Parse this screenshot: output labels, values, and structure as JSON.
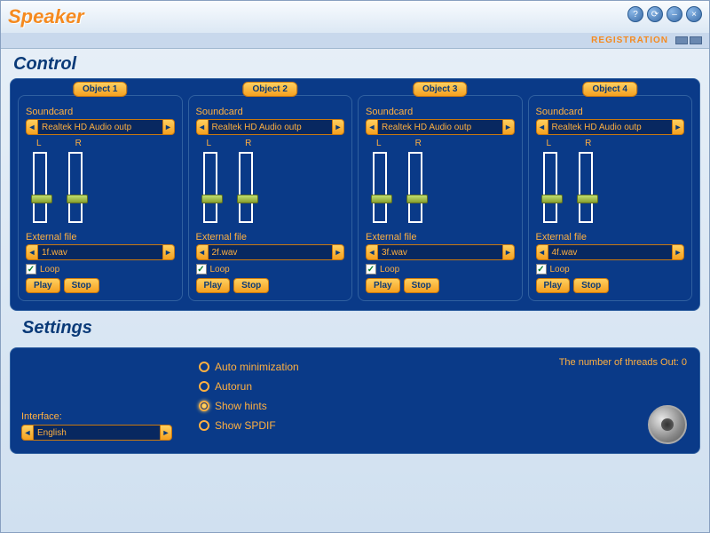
{
  "app": {
    "title": "Speaker",
    "registration": "REGISTRATION"
  },
  "titlebar_icons": [
    "?",
    "⟳",
    "–",
    "×"
  ],
  "control": {
    "title": "Control",
    "objects": [
      {
        "tab": "Object 1",
        "soundcard_label": "Soundcard",
        "soundcard": "Realtek HD Audio outp",
        "l": "L",
        "r": "R",
        "slider_l": 46,
        "slider_r": 46,
        "ext_label": "External file",
        "file": "1f.wav",
        "loop_label": "Loop",
        "loop": true,
        "play": "Play",
        "stop": "Stop"
      },
      {
        "tab": "Object 2",
        "soundcard_label": "Soundcard",
        "soundcard": "Realtek HD Audio outp",
        "l": "L",
        "r": "R",
        "slider_l": 46,
        "slider_r": 46,
        "ext_label": "External file",
        "file": "2f.wav",
        "loop_label": "Loop",
        "loop": true,
        "play": "Play",
        "stop": "Stop"
      },
      {
        "tab": "Object 3",
        "soundcard_label": "Soundcard",
        "soundcard": "Realtek HD Audio outp",
        "l": "L",
        "r": "R",
        "slider_l": 46,
        "slider_r": 46,
        "ext_label": "External file",
        "file": "3f.wav",
        "loop_label": "Loop",
        "loop": true,
        "play": "Play",
        "stop": "Stop"
      },
      {
        "tab": "Object 4",
        "soundcard_label": "Soundcard",
        "soundcard": "Realtek HD Audio outp",
        "l": "L",
        "r": "R",
        "slider_l": 46,
        "slider_r": 46,
        "ext_label": "External file",
        "file": "4f.wav",
        "loop_label": "Loop",
        "loop": true,
        "play": "Play",
        "stop": "Stop"
      }
    ]
  },
  "settings": {
    "title": "Settings",
    "interface_label": "Interface:",
    "interface": "English",
    "options": [
      {
        "label": "Auto minimization",
        "on": false
      },
      {
        "label": "Autorun",
        "on": false
      },
      {
        "label": "Show hints",
        "on": true
      },
      {
        "label": "Show SPDIF",
        "on": false
      }
    ],
    "threads": "The number of threads Out: 0"
  }
}
